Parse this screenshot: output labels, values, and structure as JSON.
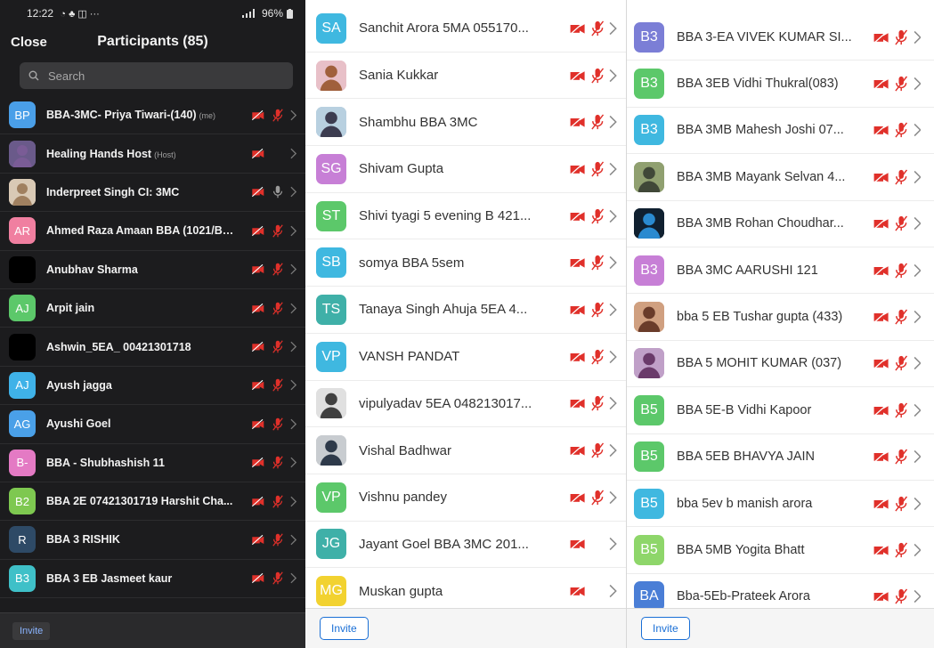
{
  "status_bar": {
    "time": "12:22",
    "indicators": "◔ ♣ ◫ ···",
    "battery": "96%"
  },
  "header": {
    "close_label": "Close",
    "title": "Participants (85)"
  },
  "search": {
    "placeholder": "Search"
  },
  "footer": {
    "invite_label": "Invite"
  },
  "colors": {
    "mute_red": "#e0302a",
    "accent_blue": "#1a6fd6",
    "dark_bg": "#1c1c1e"
  },
  "panel1": [
    {
      "initials": "BP",
      "name": "BBA-3MC- Priya Tiwari-(140)",
      "tag": "(me)",
      "color": "#4a9fe8",
      "video": true,
      "mic": "muted"
    },
    {
      "initials": "",
      "name": "Healing Hands Host",
      "tag": "(Host)",
      "color": "#6a5a8a",
      "photo": "#7a5c96",
      "video": true,
      "mic": "none"
    },
    {
      "initials": "",
      "name": "Inderpreet Singh CI: 3MC",
      "color": "#d9c9b5",
      "photo": "#a08060",
      "video": true,
      "mic": "on"
    },
    {
      "initials": "AR",
      "name": "Ahmed Raza Amaan BBA (1021/B/...",
      "color": "#f07fa0",
      "video": true,
      "mic": "muted"
    },
    {
      "initials": "",
      "name": "Anubhav Sharma",
      "color": "#000000",
      "video": true,
      "mic": "muted"
    },
    {
      "initials": "AJ",
      "name": "Arpit jain",
      "color": "#5cc86a",
      "video": true,
      "mic": "muted"
    },
    {
      "initials": "",
      "name": "Ashwin_5EA_ 00421301718",
      "color": "#000000",
      "video": true,
      "mic": "muted"
    },
    {
      "initials": "AJ",
      "name": "Ayush jagga",
      "color": "#3fb2e8",
      "video": true,
      "mic": "muted"
    },
    {
      "initials": "AG",
      "name": "Ayushi Goel",
      "color": "#4aa0e8",
      "video": true,
      "mic": "muted"
    },
    {
      "initials": "B-",
      "name": "BBA - Shubhashish 11",
      "color": "#e47ac4",
      "video": true,
      "mic": "muted"
    },
    {
      "initials": "B2",
      "name": "BBA 2E 07421301719 Harshit Cha...",
      "color": "#7ec850",
      "video": true,
      "mic": "muted"
    },
    {
      "initials": "R",
      "name": "BBA 3 RISHIK",
      "color": "#2e4a66",
      "video": true,
      "mic": "muted"
    },
    {
      "initials": "B3",
      "name": "BBA 3 EB Jasmeet kaur",
      "color": "#3fc0c8",
      "video": true,
      "mic": "muted"
    }
  ],
  "panel2": [
    {
      "initials": "SA",
      "name": "Sanchit Arora 5MA 055170...",
      "color": "#3fb8e0",
      "video": true,
      "mic": "muted"
    },
    {
      "initials": "",
      "name": "Sania Kukkar",
      "color": "#e8c0c8",
      "photo": "#a0603c",
      "video": true,
      "mic": "muted"
    },
    {
      "initials": "",
      "name": "Shambhu BBA 3MC",
      "color": "#b8d0e0",
      "photo": "#3c3c50",
      "video": true,
      "mic": "muted"
    },
    {
      "initials": "SG",
      "name": "Shivam Gupta",
      "color": "#c77fd6",
      "video": true,
      "mic": "muted"
    },
    {
      "initials": "ST",
      "name": "Shivi tyagi 5 evening B 421...",
      "color": "#5cc86a",
      "video": true,
      "mic": "muted"
    },
    {
      "initials": "SB",
      "name": "somya BBA 5sem",
      "color": "#3fb8e0",
      "video": true,
      "mic": "muted"
    },
    {
      "initials": "TS",
      "name": "Tanaya Singh Ahuja 5EA 4...",
      "color": "#3fb0a8",
      "video": true,
      "mic": "muted"
    },
    {
      "initials": "VP",
      "name": "VANSH PANDAT",
      "color": "#3fb8e0",
      "video": true,
      "mic": "muted"
    },
    {
      "initials": "",
      "name": "vipulyadav 5EA 048213017...",
      "color": "#e0e0e0",
      "photo": "#404040",
      "video": true,
      "mic": "muted"
    },
    {
      "initials": "",
      "name": "Vishal Badhwar",
      "color": "#c8ccd0",
      "photo": "#2e3a4a",
      "video": true,
      "mic": "muted"
    },
    {
      "initials": "VP",
      "name": "Vishnu pandey",
      "color": "#5cc86a",
      "video": true,
      "mic": "muted"
    },
    {
      "initials": "JG",
      "name": "Jayant Goel BBA 3MC 201...",
      "color": "#3fb0a8",
      "video": true,
      "mic": "none"
    },
    {
      "initials": "MG",
      "name": "Muskan gupta",
      "color": "#f2d230",
      "video": true,
      "mic": "none"
    }
  ],
  "panel3": [
    {
      "initials": "B3",
      "name": "BBA 3-EA VIVEK KUMAR SI...",
      "color": "#7b7ed6",
      "video": true,
      "mic": "muted"
    },
    {
      "initials": "B3",
      "name": "BBA 3EB Vidhi Thukral(083)",
      "color": "#5cc86a",
      "video": true,
      "mic": "muted"
    },
    {
      "initials": "B3",
      "name": "BBA 3MB Mahesh Joshi 07...",
      "color": "#3fb8e0",
      "video": true,
      "mic": "muted"
    },
    {
      "initials": "",
      "name": "BBA 3MB Mayank Selvan 4...",
      "color": "#90a070",
      "photo": "#404838",
      "video": true,
      "mic": "muted"
    },
    {
      "initials": "",
      "name": "BBA 3MB Rohan Choudhar...",
      "color": "#102030",
      "photo": "#2a8ad0",
      "video": true,
      "mic": "muted"
    },
    {
      "initials": "B3",
      "name": "BBA 3MC AARUSHI 121",
      "color": "#c77fd6",
      "video": true,
      "mic": "muted"
    },
    {
      "initials": "",
      "name": "bba 5 EB Tushar gupta (433)",
      "color": "#d0a080",
      "photo": "#6a3c2a",
      "video": true,
      "mic": "muted"
    },
    {
      "initials": "",
      "name": "BBA 5 MOHIT KUMAR (037)",
      "color": "#c0a0c8",
      "photo": "#6a3a6a",
      "video": true,
      "mic": "muted"
    },
    {
      "initials": "B5",
      "name": "BBA 5E-B Vidhi Kapoor",
      "color": "#5cc86a",
      "video": true,
      "mic": "muted"
    },
    {
      "initials": "B5",
      "name": "BBA 5EB BHAVYA JAIN",
      "color": "#5cc86a",
      "video": true,
      "mic": "muted"
    },
    {
      "initials": "B5",
      "name": "bba 5ev b manish arora",
      "color": "#3fb8e0",
      "video": true,
      "mic": "muted"
    },
    {
      "initials": "B5",
      "name": "BBA 5MB Yogita Bhatt",
      "color": "#8ed66a",
      "video": true,
      "mic": "muted"
    },
    {
      "initials": "BA",
      "name": "Bba-5Eb-Prateek Arora",
      "color": "#4a7ed6",
      "video": true,
      "mic": "muted"
    }
  ]
}
